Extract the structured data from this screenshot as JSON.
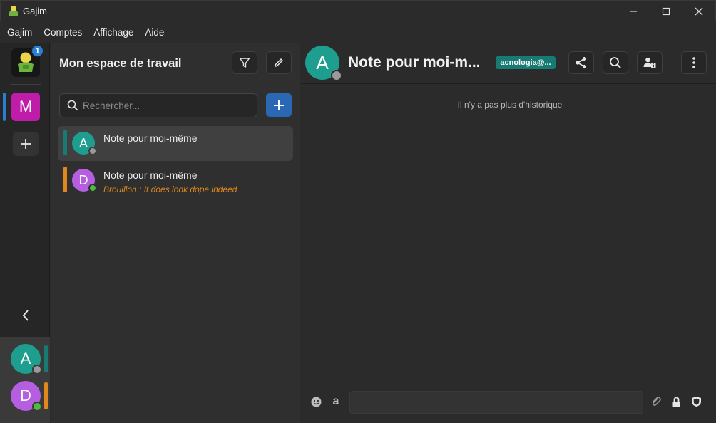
{
  "window": {
    "title": "Gajim",
    "controls": [
      "minimize-icon",
      "maximize-icon",
      "close-icon"
    ]
  },
  "menubar": {
    "items": [
      "Gajim",
      "Comptes",
      "Affichage",
      "Aide"
    ]
  },
  "workspace_rail": {
    "notification_count": "1",
    "workspace_letter": "M",
    "workspace_color": "#c01caa",
    "accounts": [
      {
        "letter": "A",
        "color": "#1d9e8f",
        "status_color": "#9a9a9a",
        "bar_color": "#177a73"
      },
      {
        "letter": "D",
        "color": "#b55fe0",
        "status_color": "#4fb940",
        "bar_color": "#e0871d"
      }
    ]
  },
  "chat_list": {
    "workspace_title": "Mon espace de travail",
    "search_placeholder": "Rechercher...",
    "chats": [
      {
        "letter": "A",
        "name": "Note pour moi-même",
        "draft": "",
        "avatar_color": "#1d9e8f",
        "status_color": "#9a9a9a",
        "strip_color": "#177a73",
        "selected": true
      },
      {
        "letter": "D",
        "name": "Note pour moi-même",
        "draft": "Brouillon : It does look dope indeed",
        "avatar_color": "#b55fe0",
        "status_color": "#4fb940",
        "strip_color": "#e0871d",
        "selected": false
      }
    ]
  },
  "conversation": {
    "avatar_letter": "A",
    "title": "Note pour moi-m...",
    "jid_badge": "acnologia@...",
    "no_history": "Il n'y a pas plus d'historique",
    "composer_letter": "a",
    "header_actions": [
      "share-icon",
      "search-icon",
      "contact-info-icon",
      "more-menu-icon"
    ]
  },
  "colors": {
    "accent_blue": "#2a67b4",
    "teal": "#1d9e8f",
    "orange": "#e0871d",
    "magenta": "#c01caa"
  }
}
